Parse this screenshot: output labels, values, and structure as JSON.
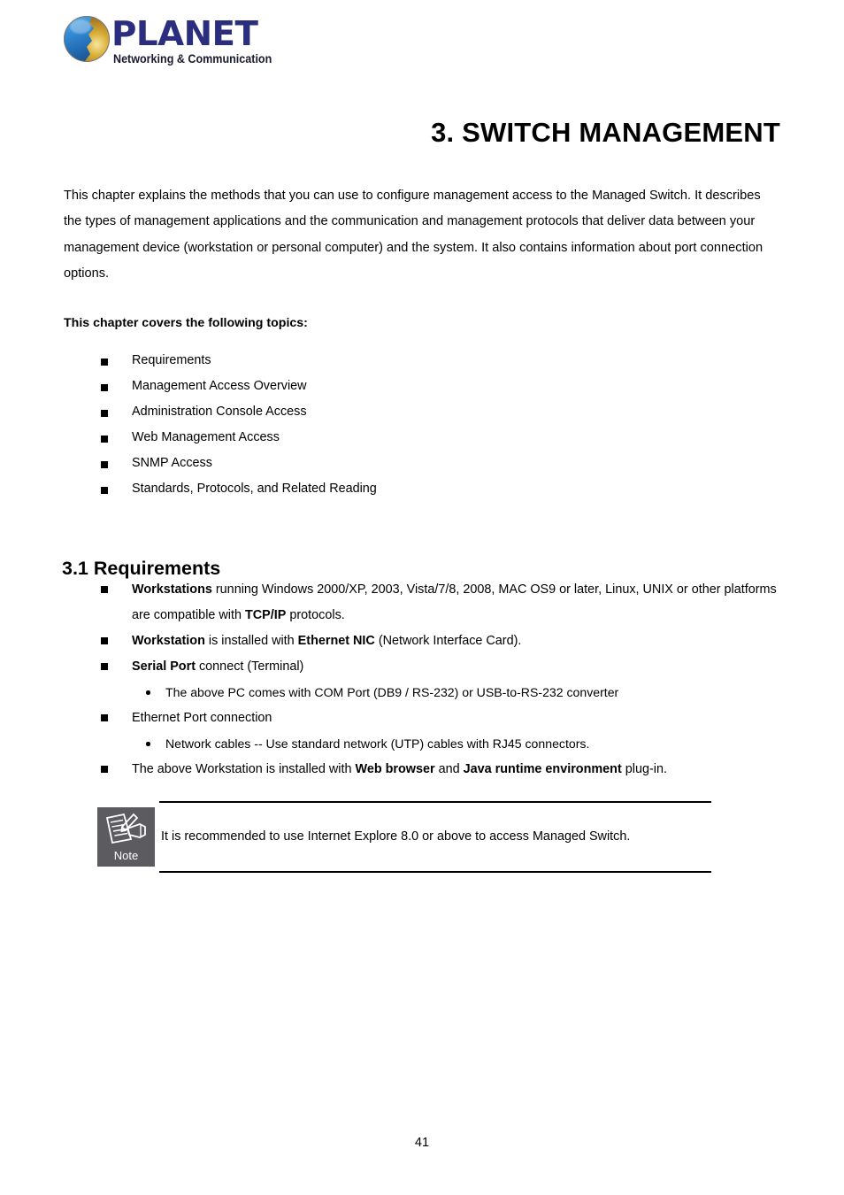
{
  "header": {
    "logo": {
      "wordmark": "PLANET",
      "tagline": "Networking & Communication",
      "globe_icon": "planet-globe-icon",
      "wordmark_color": "#2b2d7f"
    }
  },
  "chapter": {
    "title": "3. SWITCH MANAGEMENT",
    "intro": "This chapter explains the methods that you can use to configure management access to the Managed Switch. It describes the types of management applications and the communication and management protocols that deliver data between your management device (workstation or personal computer) and the system. It also contains information about port connection options."
  },
  "topics": {
    "heading": "This chapter covers the following topics:",
    "items": [
      {
        "label": "Requirements"
      },
      {
        "label": "Management Access Overview"
      },
      {
        "label": "Administration Console Access"
      },
      {
        "label": "Web Management Access"
      },
      {
        "label": "SNMP Access"
      },
      {
        "label": "Standards, Protocols, and Related Reading"
      }
    ]
  },
  "section": {
    "heading": "3.1 Requirements",
    "requirements": [
      {
        "type": "square",
        "html": "<b>Workstations</b> running Windows 2000/XP, 2003, Vista/7/8, 2008, MAC OS9 or later, Linux, UNIX or other platforms are compatible with <b>TCP/IP</b> protocols."
      },
      {
        "type": "square",
        "html": "<b>Workstation</b> is installed with <b>Ethernet NIC</b> (Network Interface Card)."
      },
      {
        "type": "square",
        "html": "<b>Serial Port</b> connect (Terminal)"
      },
      {
        "type": "dot",
        "html": "The above PC comes with COM Port (DB9 / RS-232) or USB-to-RS-232 converter"
      },
      {
        "type": "square",
        "html": "Ethernet Port connection"
      },
      {
        "type": "dot",
        "html": "Network cables -- Use standard network (UTP) cables with RJ45 connectors."
      },
      {
        "type": "square",
        "html": "The above Workstation is installed with <b>Web browser</b> and <b>Java runtime environment</b> plug-in."
      }
    ]
  },
  "note": {
    "icon": "note-writing-hand-icon",
    "label": "Note",
    "text": "It is recommended to use Internet Explore 8.0 or above to access Managed Switch.",
    "box_color": "#5b5b60"
  },
  "footer": {
    "page_number": "41"
  }
}
